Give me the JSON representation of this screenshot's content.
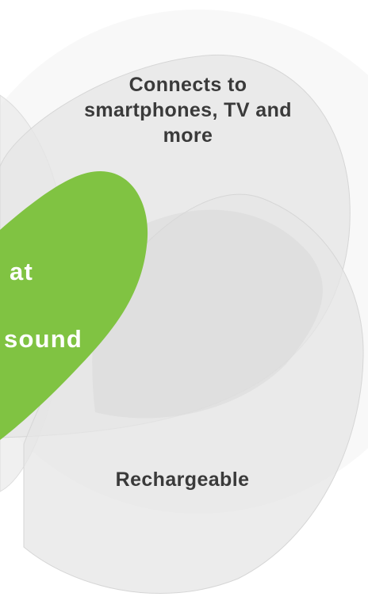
{
  "diagram": {
    "top_petal_text": "Connects to smartphones, TV and more",
    "bottom_petal_text": "Rechargeable",
    "green_heart_text_line1": "at",
    "green_heart_text_line2": "sound"
  },
  "colors": {
    "petal_fill": "#e7e7e7",
    "green_fill": "#80c342",
    "text_dark": "#3a3a3a",
    "text_light": "#ffffff"
  }
}
